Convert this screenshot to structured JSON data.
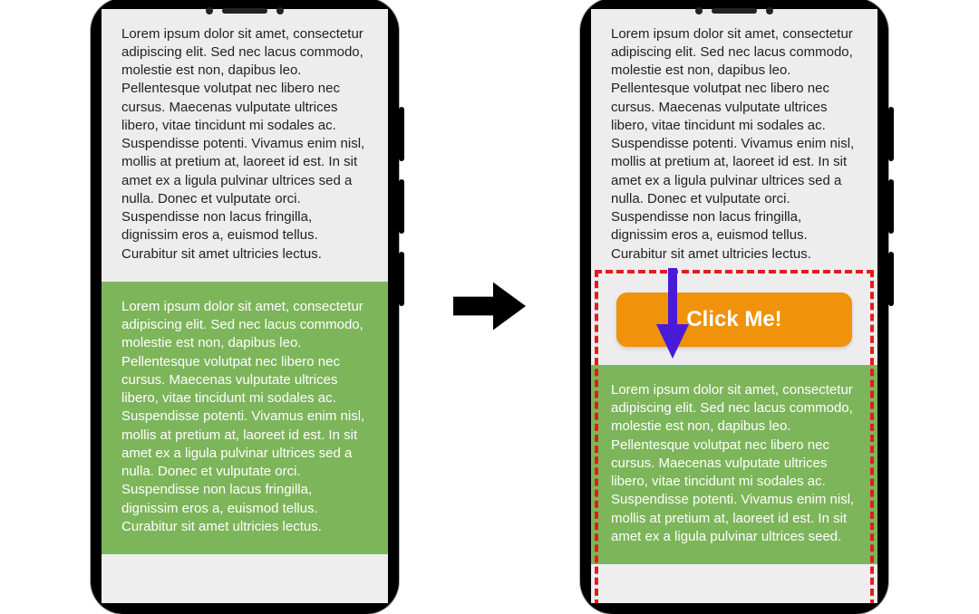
{
  "paragraph_gray": "Lorem ipsum dolor sit amet, consectetur adipiscing elit. Sed nec lacus commodo, molestie est non, dapibus leo. Pellentesque volutpat nec libero nec cursus. Maecenas vulputate ultrices libero, vitae tincidunt mi sodales ac. Suspendisse potenti. Vivamus enim nisl, mollis at pretium at, laoreet id est. In sit amet ex a ligula pulvinar ultrices sed a nulla. Donec et vulputate orci. Suspendisse non lacus fringilla, dignissim eros a, euismod tellus. Curabitur sit amet ultricies lectus.",
  "paragraph_green_full": "Lorem ipsum dolor sit amet, consectetur adipiscing elit. Sed nec lacus commodo, molestie est non, dapibus leo. Pellentesque volutpat nec libero nec cursus. Maecenas vulputate ultrices libero, vitae tincidunt mi sodales ac. Suspendisse potenti. Vivamus enim nisl, mollis at pretium at, laoreet id est. In sit amet ex a ligula pulvinar ultrices sed a nulla. Donec et vulputate orci. Suspendisse non lacus fringilla, dignissim eros a, euismod tellus. Curabitur sit amet ultricies lectus.",
  "paragraph_green_short": "Lorem ipsum dolor sit amet, consectetur adipiscing elit. Sed nec lacus commodo, molestie est non, dapibus leo. Pellentesque volutpat nec libero nec cursus. Maecenas vulputate ultrices libero, vitae tincidunt mi sodales ac. Suspendisse potenti. Vivamus enim nisl, mollis at pretium at, laoreet id est. In sit amet ex a ligula pulvinar ultrices seed.",
  "ad": {
    "button_label": "Click Me!"
  },
  "colors": {
    "green_block": "#7db55a",
    "ad_button": "#f1920b",
    "dashed_border": "#e41b1b",
    "shift_arrow": "#4a1bd6"
  }
}
